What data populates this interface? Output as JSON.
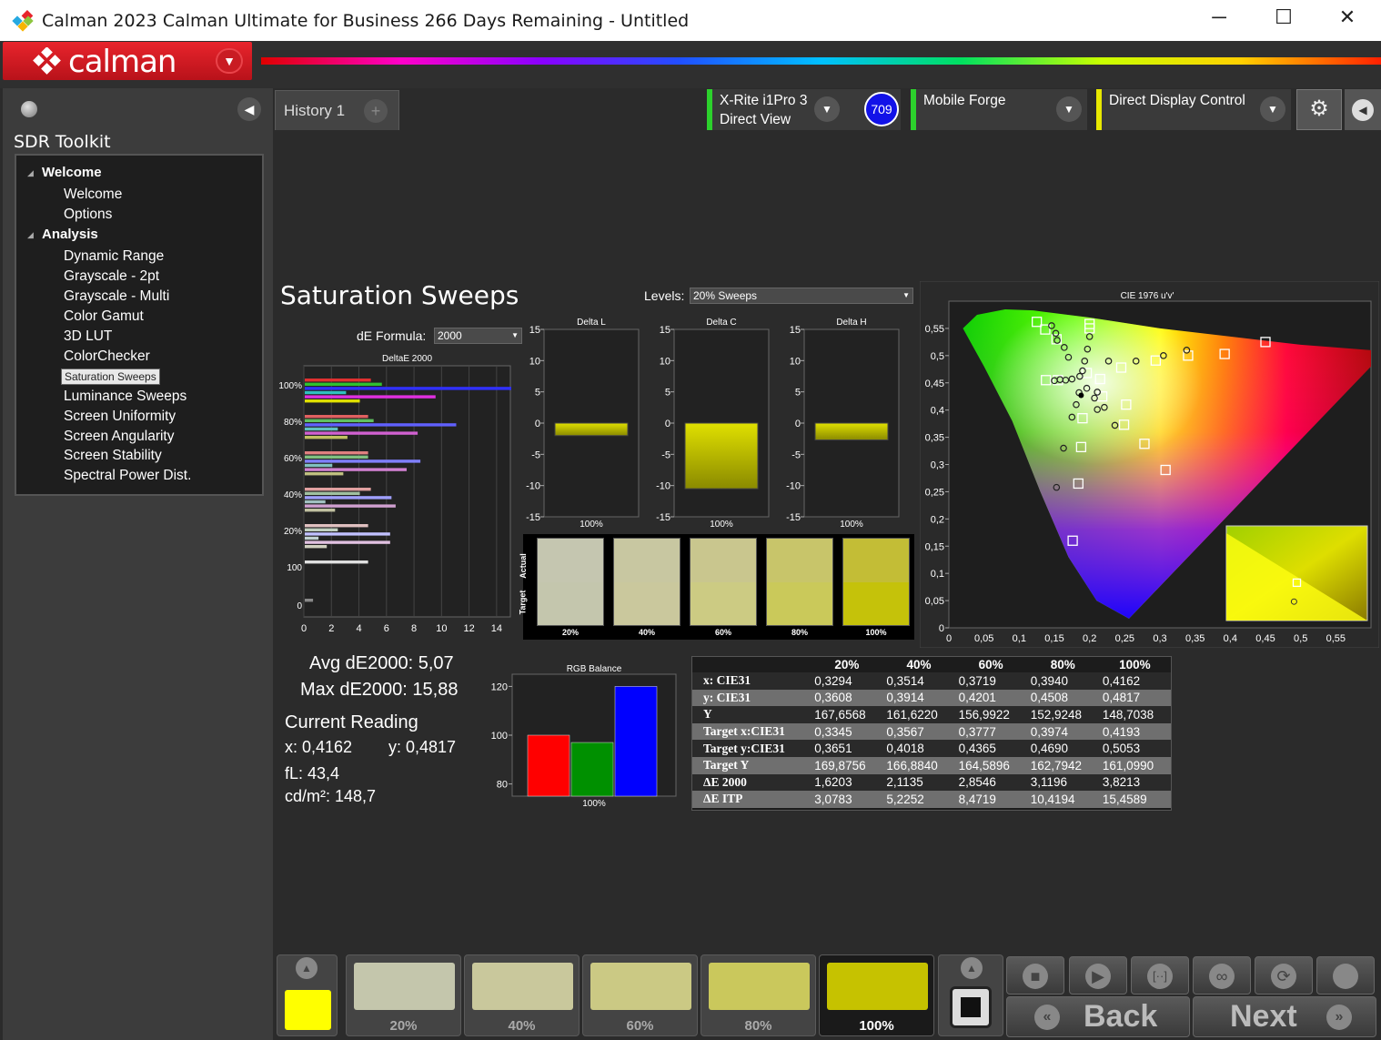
{
  "window": {
    "title": "Calman 2023 Calman Ultimate for Business 266 Days Remaining  - Untitled",
    "minimize": "─",
    "maximize": "☐",
    "close": "✕"
  },
  "app": {
    "logo_text": "calman"
  },
  "sidebar": {
    "title": "SDR Toolkit",
    "groups": [
      {
        "label": "Welcome",
        "items": [
          "Welcome",
          "Options"
        ]
      },
      {
        "label": "Analysis",
        "items": [
          "Dynamic Range",
          "Grayscale - 2pt",
          "Grayscale - Multi",
          "Color Gamut",
          "3D LUT",
          "ColorChecker",
          "Saturation Sweeps",
          "Luminance Sweeps",
          "Screen Uniformity",
          "Screen Angularity",
          "Screen Stability",
          "Spectral Power Dist."
        ]
      }
    ],
    "selected": "Saturation Sweeps"
  },
  "tabs": {
    "history": "History 1",
    "add": "+"
  },
  "devices": {
    "meter": {
      "line1": "X-Rite i1Pro 3",
      "line2": "Direct View",
      "badge": "709",
      "status_color": "#2cd12c"
    },
    "source": {
      "label": "Mobile Forge",
      "status_color": "#2cd12c"
    },
    "display": {
      "label": "Direct Display Control",
      "status_color": "#e8e800"
    }
  },
  "page": {
    "title": "Saturation Sweeps",
    "levels_label": "Levels:",
    "levels_value": "20% Sweeps",
    "de_formula_label": "dE Formula:",
    "de_formula_value": "2000",
    "avg_de": "Avg dE2000: 5,07",
    "max_de": "Max dE2000: 15,88",
    "current_reading_title": "Current Reading",
    "x_reading": "x: 0,4162",
    "y_reading": "y: 0,4817",
    "fl": "fL: 43,4",
    "cdm2": "cd/m²: 148,7"
  },
  "chart_data": [
    {
      "type": "bar",
      "title": "DeltaE 2000",
      "orientation": "horizontal",
      "categories": [
        "100%",
        "80%",
        "60%",
        "40%",
        "20%",
        "100",
        "0"
      ],
      "xlim": [
        0,
        15
      ],
      "xticks": [
        "0",
        "2",
        "4",
        "6",
        "8",
        "10",
        "12",
        "14"
      ],
      "groups": [
        {
          "label": "100%",
          "bars": [
            {
              "v": 4.8,
              "c": "#e03030"
            },
            {
              "v": 5.6,
              "c": "#30c030"
            },
            {
              "v": 15,
              "c": "#3030ff"
            },
            {
              "v": 3.0,
              "c": "#30c0c0"
            },
            {
              "v": 9.5,
              "c": "#e030e0"
            },
            {
              "v": 4.0,
              "c": "#e0e000"
            }
          ]
        },
        {
          "label": "80%",
          "bars": [
            {
              "v": 4.6,
              "c": "#e06060"
            },
            {
              "v": 5.0,
              "c": "#60c060"
            },
            {
              "v": 11,
              "c": "#6060ff"
            },
            {
              "v": 2.4,
              "c": "#60c0c0"
            },
            {
              "v": 8.2,
              "c": "#d060d0"
            },
            {
              "v": 3.1,
              "c": "#c0c060"
            }
          ]
        },
        {
          "label": "60%",
          "bars": [
            {
              "v": 4.6,
              "c": "#e08080"
            },
            {
              "v": 4.6,
              "c": "#80c080"
            },
            {
              "v": 8.4,
              "c": "#8080ff"
            },
            {
              "v": 2.0,
              "c": "#80c0c0"
            },
            {
              "v": 7.4,
              "c": "#d080d0"
            },
            {
              "v": 2.8,
              "c": "#c0c080"
            }
          ]
        },
        {
          "label": "40%",
          "bars": [
            {
              "v": 4.8,
              "c": "#e0a0a0"
            },
            {
              "v": 4.0,
              "c": "#a0c0a0"
            },
            {
              "v": 6.3,
              "c": "#a0a0ff"
            },
            {
              "v": 1.5,
              "c": "#a0c0c0"
            },
            {
              "v": 6.6,
              "c": "#d0a0d0"
            },
            {
              "v": 2.2,
              "c": "#c0c0a0"
            }
          ]
        },
        {
          "label": "20%",
          "bars": [
            {
              "v": 4.6,
              "c": "#e0c0c0"
            },
            {
              "v": 2.4,
              "c": "#c0d0c0"
            },
            {
              "v": 6.2,
              "c": "#c0c0ff"
            },
            {
              "v": 1.0,
              "c": "#c0d0d0"
            },
            {
              "v": 6.2,
              "c": "#e0c0e0"
            },
            {
              "v": 1.6,
              "c": "#d0d0c0"
            }
          ]
        },
        {
          "label": "100",
          "bars": [
            {
              "v": 4.6,
              "c": "#e0e0e0"
            }
          ]
        },
        {
          "label": "0",
          "bars": [
            {
              "v": 0.6,
              "c": "#888888"
            }
          ]
        }
      ]
    },
    {
      "type": "bar",
      "title": "Delta L",
      "categories": [
        "100%"
      ],
      "values": [
        -2.0
      ],
      "ylim": [
        -15,
        15
      ],
      "yticks": [
        "15",
        "10",
        "5",
        "0",
        "-5",
        "-10",
        "-15"
      ]
    },
    {
      "type": "bar",
      "title": "Delta C",
      "categories": [
        "100%"
      ],
      "values": [
        -10.5
      ],
      "ylim": [
        -15,
        15
      ],
      "yticks": [
        "15",
        "10",
        "5",
        "0",
        "-5",
        "-10",
        "-15"
      ]
    },
    {
      "type": "bar",
      "title": "Delta H",
      "categories": [
        "100%"
      ],
      "values": [
        -2.7
      ],
      "ylim": [
        -15,
        15
      ],
      "yticks": [
        "15",
        "10",
        "5",
        "0",
        "-5",
        "-10",
        "-15"
      ]
    },
    {
      "type": "bar",
      "title": "RGB Balance",
      "categories": [
        "100%"
      ],
      "series": [
        {
          "name": "R",
          "values": [
            100
          ]
        },
        {
          "name": "G",
          "values": [
            97
          ]
        },
        {
          "name": "B",
          "values": [
            120
          ]
        }
      ],
      "colors": [
        "#ff0000",
        "#009000",
        "#0000ff"
      ],
      "ylim": [
        75,
        125
      ],
      "yticks": [
        "120",
        "100",
        "80"
      ]
    },
    {
      "type": "scatter",
      "title": "CIE 1976 u'v'",
      "xlim": [
        0,
        0.6
      ],
      "ylim": [
        0,
        0.6
      ],
      "xticks": [
        "0",
        "0,05",
        "0,1",
        "0,15",
        "0,2",
        "0,25",
        "0,3",
        "0,35",
        "0,4",
        "0,45",
        "0,5",
        "0,55"
      ],
      "yticks": [
        "0",
        "0,05",
        "0,1",
        "0,15",
        "0,2",
        "0,25",
        "0,3",
        "0,35",
        "0,4",
        "0,45",
        "0,5",
        "0,55"
      ],
      "targets": [
        [
          0.125,
          0.562
        ],
        [
          0.137,
          0.548
        ],
        [
          0.2,
          0.558
        ],
        [
          0.153,
          0.53
        ],
        [
          0.2,
          0.55
        ],
        [
          0.196,
          0.468
        ],
        [
          0.138,
          0.455
        ],
        [
          0.155,
          0.455
        ],
        [
          0.215,
          0.457
        ],
        [
          0.245,
          0.478
        ],
        [
          0.294,
          0.491
        ],
        [
          0.34,
          0.5
        ],
        [
          0.392,
          0.503
        ],
        [
          0.45,
          0.525
        ],
        [
          0.252,
          0.41
        ],
        [
          0.218,
          0.425
        ],
        [
          0.249,
          0.373
        ],
        [
          0.278,
          0.338
        ],
        [
          0.308,
          0.29
        ],
        [
          0.19,
          0.385
        ],
        [
          0.188,
          0.332
        ],
        [
          0.184,
          0.265
        ],
        [
          0.176,
          0.16
        ]
      ],
      "measured": [
        [
          0.146,
          0.555
        ],
        [
          0.152,
          0.541
        ],
        [
          0.154,
          0.528
        ],
        [
          0.164,
          0.515
        ],
        [
          0.17,
          0.497
        ],
        [
          0.2,
          0.535
        ],
        [
          0.197,
          0.512
        ],
        [
          0.193,
          0.49
        ],
        [
          0.19,
          0.472
        ],
        [
          0.186,
          0.462
        ],
        [
          0.175,
          0.457
        ],
        [
          0.166,
          0.455
        ],
        [
          0.158,
          0.456
        ],
        [
          0.15,
          0.454
        ],
        [
          0.185,
          0.432
        ],
        [
          0.181,
          0.41
        ],
        [
          0.175,
          0.387
        ],
        [
          0.163,
          0.33
        ],
        [
          0.153,
          0.258
        ],
        [
          0.227,
          0.49
        ],
        [
          0.266,
          0.49
        ],
        [
          0.305,
          0.5
        ],
        [
          0.338,
          0.51
        ],
        [
          0.211,
          0.433
        ],
        [
          0.221,
          0.405
        ],
        [
          0.236,
          0.372
        ],
        [
          0.196,
          0.44
        ],
        [
          0.207,
          0.422
        ],
        [
          0.211,
          0.401
        ]
      ],
      "current": [
        0.188,
        0.427
      ],
      "inset_target": [
        0.5,
        0.4
      ],
      "inset_measured": [
        0.48,
        0.2
      ]
    }
  ],
  "swatches": {
    "labels": [
      "20%",
      "40%",
      "60%",
      "80%",
      "100%"
    ],
    "actual": [
      "#c5c6b0",
      "#c8c7a1",
      "#c9c68e",
      "#c8c56a",
      "#c3bd36"
    ],
    "target": [
      "#c4c6ad",
      "#cac89d",
      "#cccb83",
      "#cac95a",
      "#c5c20a"
    ],
    "actual_label": "Actual",
    "target_label": "Target"
  },
  "table": {
    "columns": [
      "",
      "20%",
      "40%",
      "60%",
      "80%",
      "100%"
    ],
    "rows": [
      [
        "x: CIE31",
        "0,3294",
        "0,3514",
        "0,3719",
        "0,3940",
        "0,4162"
      ],
      [
        "y: CIE31",
        "0,3608",
        "0,3914",
        "0,4201",
        "0,4508",
        "0,4817"
      ],
      [
        "Y",
        "167,6568",
        "161,6220",
        "156,9922",
        "152,9248",
        "148,7038"
      ],
      [
        "Target x:CIE31",
        "0,3345",
        "0,3567",
        "0,3777",
        "0,3974",
        "0,4193"
      ],
      [
        "Target y:CIE31",
        "0,3651",
        "0,4018",
        "0,4365",
        "0,4690",
        "0,5053"
      ],
      [
        "Target Y",
        "169,8756",
        "166,8840",
        "164,5896",
        "162,7942",
        "161,0990"
      ],
      [
        "ΔE 2000",
        "1,6203",
        "2,1135",
        "2,8546",
        "3,1196",
        "3,8213"
      ],
      [
        "ΔE ITP",
        "3,0783",
        "5,2252",
        "8,4719",
        "10,4194",
        "15,4589"
      ]
    ]
  },
  "bottom": {
    "current_color": "#ffff00",
    "patches": [
      {
        "label": "20%",
        "color": "#c4c6ac"
      },
      {
        "label": "40%",
        "color": "#c9c89c"
      },
      {
        "label": "60%",
        "color": "#cbc984"
      },
      {
        "label": "80%",
        "color": "#cac85c"
      },
      {
        "label": "100%",
        "color": "#c6c200",
        "active": true
      }
    ],
    "back_label": "Back",
    "next_label": "Next"
  }
}
